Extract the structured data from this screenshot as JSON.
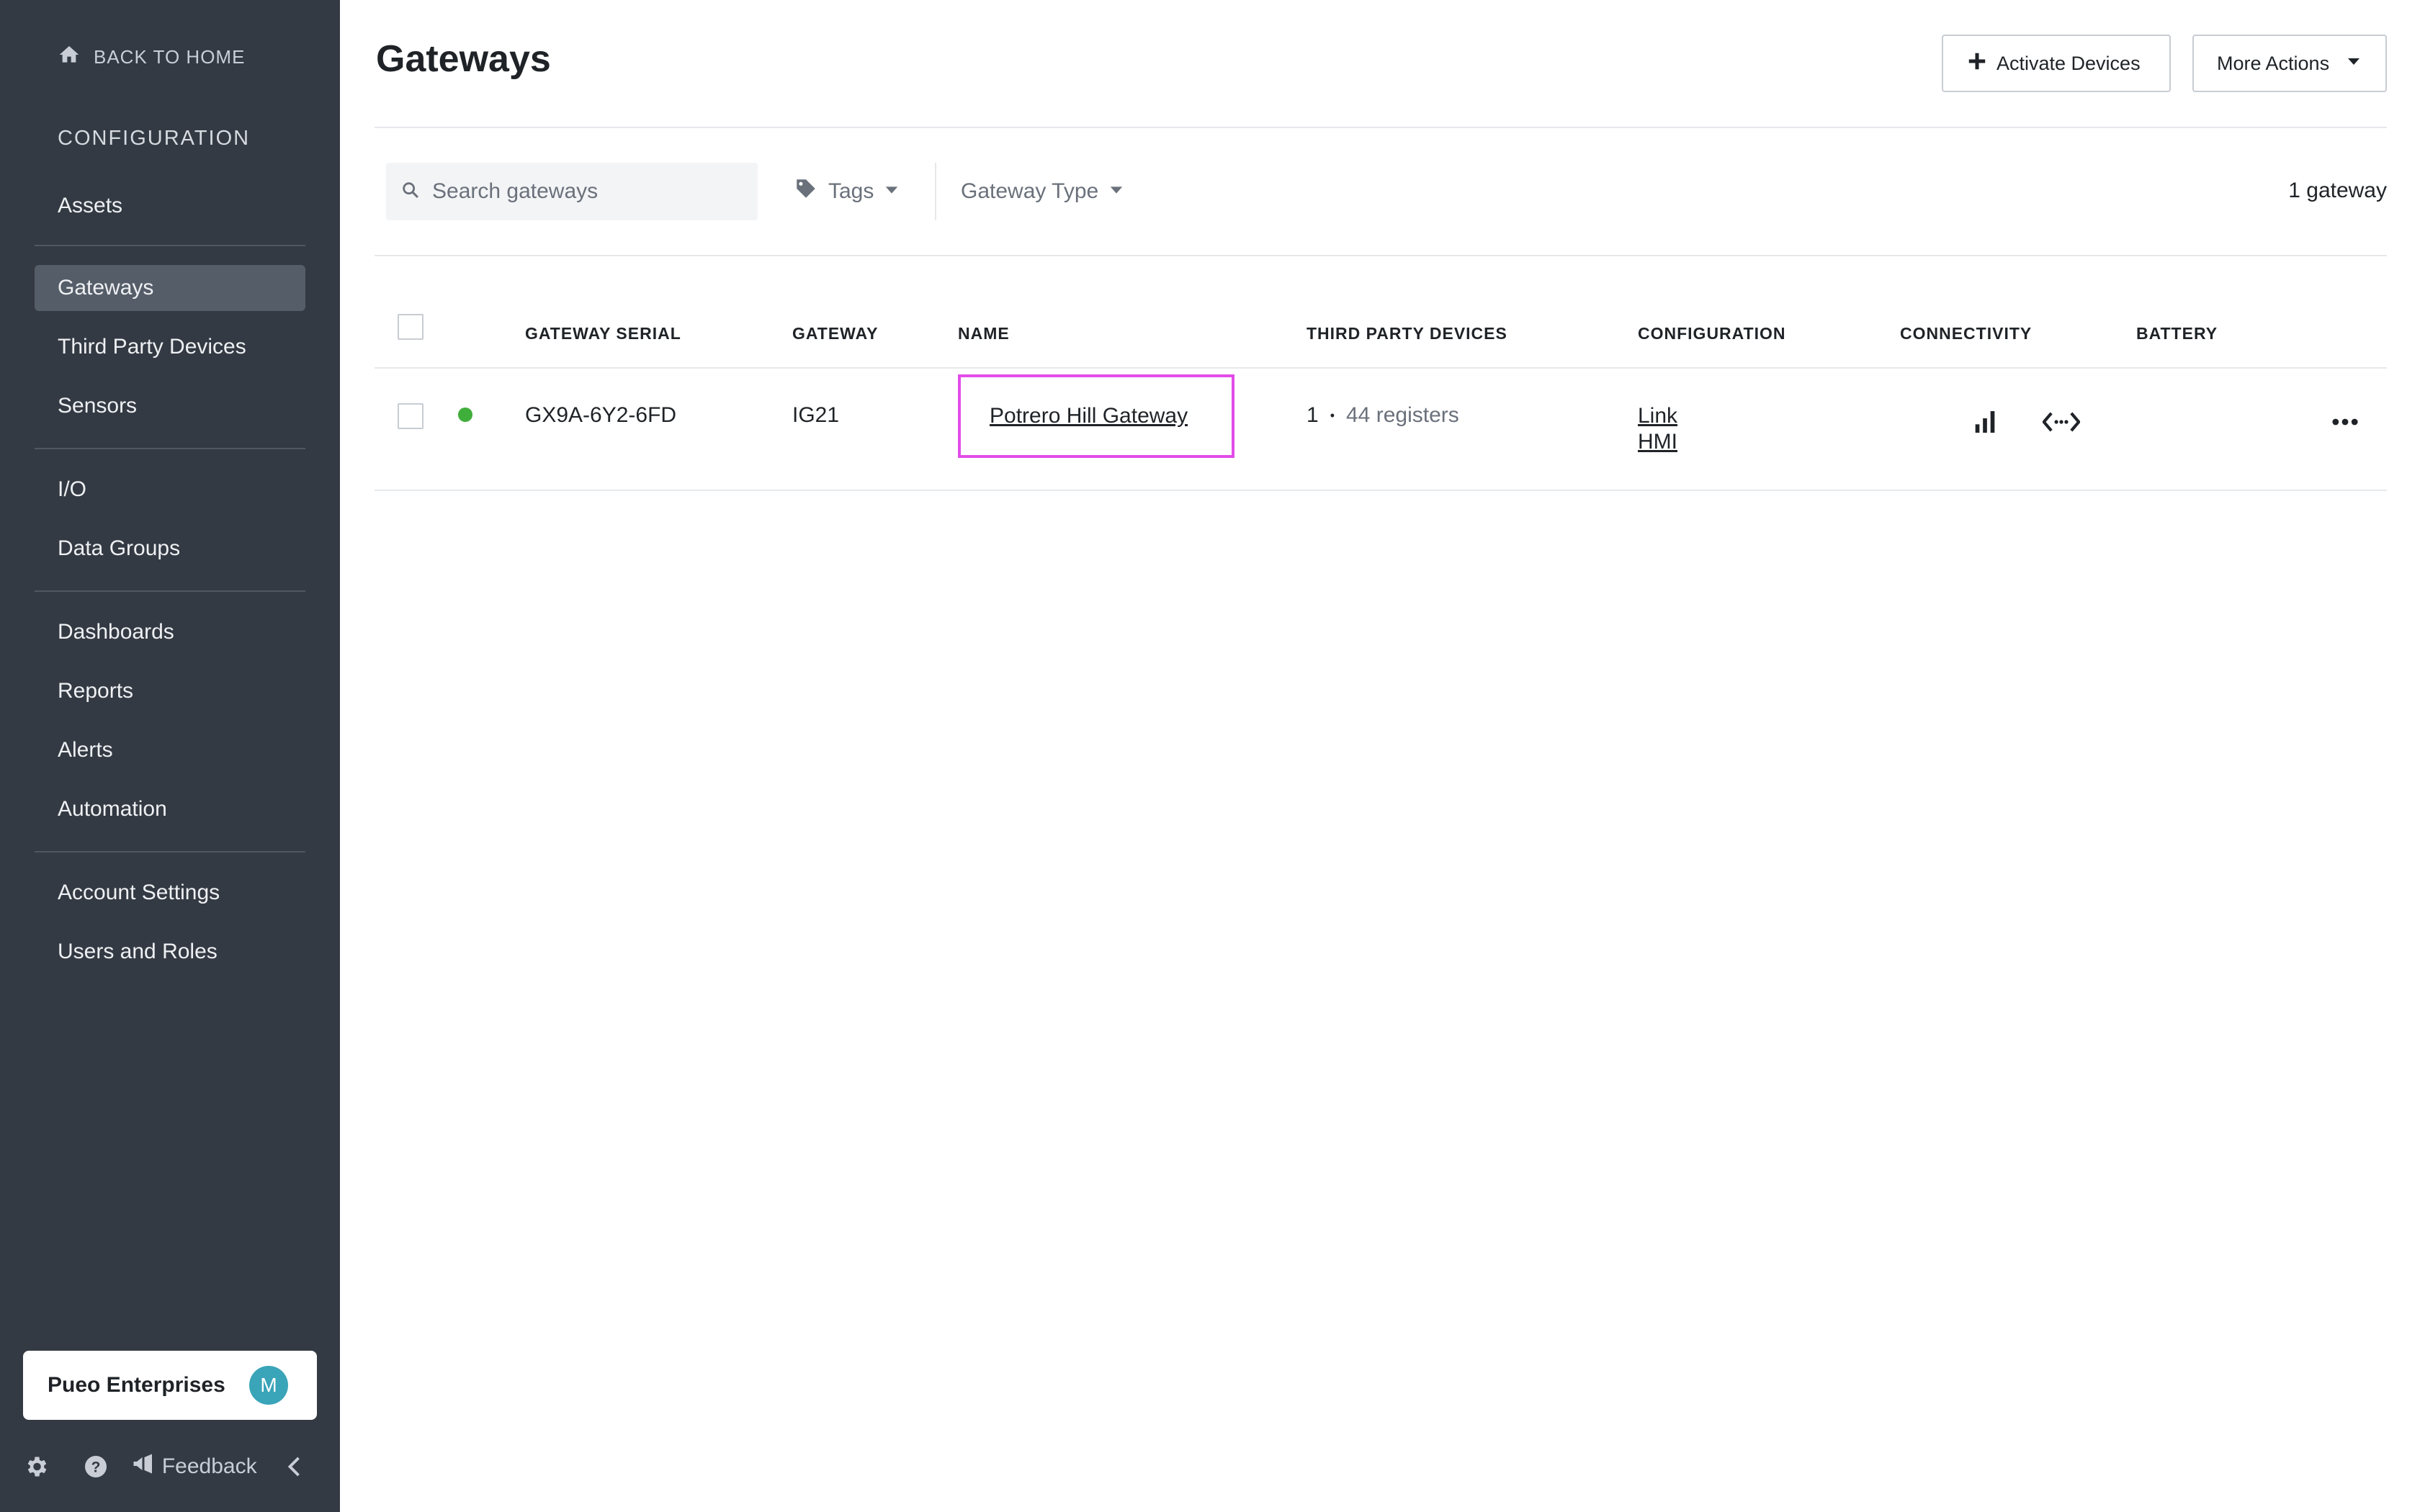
{
  "sidebar": {
    "back_home": "BACK TO HOME",
    "section_title": "CONFIGURATION",
    "items": [
      {
        "label": "Assets"
      },
      {
        "label": "Gateways"
      },
      {
        "label": "Third Party Devices"
      },
      {
        "label": "Sensors"
      },
      {
        "label": "I/O"
      },
      {
        "label": "Data Groups"
      },
      {
        "label": "Dashboards"
      },
      {
        "label": "Reports"
      },
      {
        "label": "Alerts"
      },
      {
        "label": "Automation"
      },
      {
        "label": "Account Settings"
      },
      {
        "label": "Users and Roles"
      }
    ],
    "active_item": "Gateways",
    "org": {
      "name": "Pueo Enterprises",
      "avatar_initial": "M",
      "avatar_color": "#3aa4b8"
    },
    "footer": {
      "feedback": "Feedback"
    }
  },
  "header": {
    "title": "Gateways",
    "activate_label": "Activate Devices",
    "more_label": "More Actions"
  },
  "filters": {
    "search_placeholder": "Search gateways",
    "tags_label": "Tags",
    "type_label": "Gateway Type",
    "count_label": "1 gateway"
  },
  "table": {
    "columns": [
      "GATEWAY SERIAL",
      "GATEWAY",
      "NAME",
      "THIRD PARTY DEVICES",
      "CONFIGURATION",
      "CONNECTIVITY",
      "BATTERY"
    ],
    "rows": [
      {
        "status_color": "#3fae3a",
        "serial": "GX9A-6Y2-6FD",
        "gateway": "IG21",
        "name": "Potrero Hill Gateway",
        "devices_count": "1",
        "devices_sep": "•",
        "registers": "44 registers",
        "config_links": [
          "Link",
          "HMI"
        ]
      }
    ]
  },
  "colors": {
    "sidebar_bg": "#343a43",
    "highlight": "#e24ce8",
    "status_online": "#3fae3a"
  }
}
